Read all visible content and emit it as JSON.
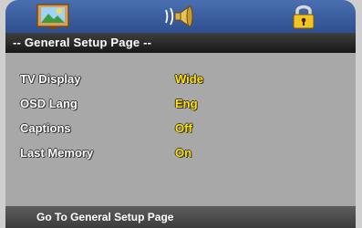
{
  "tabs": [
    {
      "icon": "picture-icon"
    },
    {
      "icon": "speaker-icon"
    },
    {
      "icon": "lock-icon"
    }
  ],
  "header": {
    "title": "-- General Setup Page --"
  },
  "settings": [
    {
      "label": "TV Display",
      "value": "Wide"
    },
    {
      "label": "OSD Lang",
      "value": "Eng"
    },
    {
      "label": "Captions",
      "value": "Off"
    },
    {
      "label": "Last Memory",
      "value": "On"
    }
  ],
  "footer": {
    "text": "Go To General Setup Page"
  },
  "colors": {
    "topbar": "#3d5f9f",
    "header": "#222222",
    "panel": "#a8a8a8",
    "value": "#ffe000",
    "label": "#ffffff"
  }
}
